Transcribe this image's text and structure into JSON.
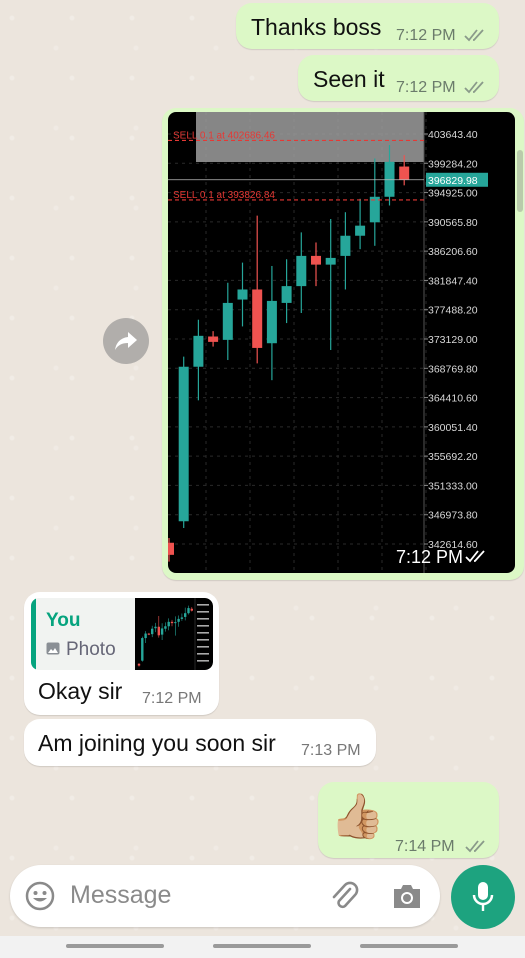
{
  "messages": [
    {
      "text": "Thanks boss",
      "time": "7:12 PM",
      "direction": "out",
      "status": "read"
    },
    {
      "text": "Seen it",
      "time": "7:12 PM",
      "direction": "out",
      "status": "read"
    },
    {
      "type": "image",
      "time": "7:12 PM",
      "direction": "out",
      "status": "read"
    },
    {
      "quote_author": "You",
      "quote_type": "Photo",
      "text": "Okay sir",
      "time": "7:12 PM",
      "direction": "in"
    },
    {
      "text": "Am joining you soon sir",
      "time": "7:13 PM",
      "direction": "in"
    },
    {
      "emoji": "👍🏼",
      "time": "7:14 PM",
      "direction": "out",
      "status": "read"
    }
  ],
  "chart_data": {
    "type": "candlestick",
    "orders": [
      {
        "label": "SELL 0.1 at 402686.46",
        "price": 402686.46
      },
      {
        "label": "SELL 0.1 at 393826.84",
        "price": 393826.84
      }
    ],
    "current_price": "396829.98",
    "ticks": [
      "403643.40",
      "399284.20",
      "394925.00",
      "390565.80",
      "386206.60",
      "381847.40",
      "377488.20",
      "373129.00",
      "368769.80",
      "364410.60",
      "360051.40",
      "355692.20",
      "351333.00",
      "346973.80",
      "342614.60"
    ],
    "tick_values": [
      403643.4,
      399284.2,
      394925.0,
      390565.8,
      386206.6,
      381847.4,
      377488.2,
      373129.0,
      368769.8,
      364410.6,
      360051.4,
      355692.2,
      351333.0,
      346973.8,
      342614.6
    ],
    "candles": [
      {
        "o": 342800,
        "c": 341000,
        "h": 343500,
        "l": 340000
      },
      {
        "o": 346000,
        "c": 369000,
        "h": 370500,
        "l": 345000
      },
      {
        "o": 369000,
        "c": 373600,
        "h": 376000,
        "l": 364000
      },
      {
        "o": 373500,
        "c": 372700,
        "h": 374300,
        "l": 372000
      },
      {
        "o": 373000,
        "c": 378500,
        "h": 381500,
        "l": 370000
      },
      {
        "o": 379000,
        "c": 380500,
        "h": 384500,
        "l": 375000
      },
      {
        "o": 380500,
        "c": 371800,
        "h": 391500,
        "l": 369500
      },
      {
        "o": 372500,
        "c": 378800,
        "h": 384000,
        "l": 367000
      },
      {
        "o": 378500,
        "c": 381000,
        "h": 385000,
        "l": 375500
      },
      {
        "o": 381000,
        "c": 385500,
        "h": 389000,
        "l": 377000
      },
      {
        "o": 385500,
        "c": 384200,
        "h": 387500,
        "l": 381000
      },
      {
        "o": 384200,
        "c": 385200,
        "h": 391000,
        "l": 371500
      },
      {
        "o": 385500,
        "c": 388500,
        "h": 392000,
        "l": 380500
      },
      {
        "o": 388500,
        "c": 390000,
        "h": 394000,
        "l": 386500
      },
      {
        "o": 390500,
        "c": 394300,
        "h": 400000,
        "l": 387000
      },
      {
        "o": 394300,
        "c": 399500,
        "h": 402000,
        "l": 393000
      },
      {
        "o": 398800,
        "c": 396830,
        "h": 400500,
        "l": 396000
      }
    ]
  },
  "reply": {
    "author": "You",
    "type_label": "Photo"
  },
  "composer": {
    "placeholder": "Message"
  },
  "colors": {
    "outgoing": "#dcf8c6",
    "incoming": "#ffffff",
    "accent": "#1da37f",
    "bull": "#26a69a",
    "bear": "#ef5350"
  }
}
